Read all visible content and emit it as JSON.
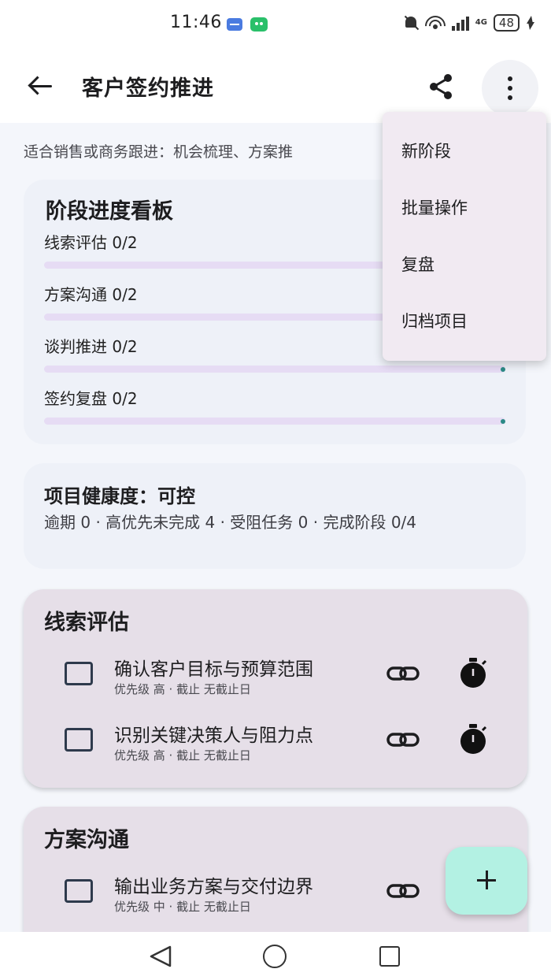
{
  "status_bar": {
    "time": "11:46",
    "network_label": "4G",
    "battery": "48",
    "icons": [
      "usb-icon",
      "wechat-icon",
      "bell-muted-icon",
      "wifi-icon",
      "signal-icon",
      "battery-icon",
      "charging-icon"
    ]
  },
  "app_bar": {
    "title": "客户签约推进",
    "icons": [
      "back-arrow-icon",
      "share-icon",
      "more-vert-icon"
    ]
  },
  "subtitle": "适合销售或商务跟进：机会梳理、方案推",
  "board": {
    "title": "阶段进度看板",
    "stages": [
      {
        "label": "线索评估  0/2",
        "progress": 0
      },
      {
        "label": "方案沟通  0/2",
        "progress": 0
      },
      {
        "label": "谈判推进  0/2",
        "progress": 0
      },
      {
        "label": "签约复盘  0/2",
        "progress": 0
      }
    ]
  },
  "health": {
    "title": "项目健康度：可控",
    "meta": "逾期 0 · 高优先未完成 4 · 受阻任务 0 · 完成阶段 0/4"
  },
  "sections": [
    {
      "title": "线索评估",
      "tasks": [
        {
          "name": "确认客户目标与预算范围",
          "meta": "优先级 高 · 截止 无截止日"
        },
        {
          "name": "识别关键决策人与阻力点",
          "meta": "优先级 高 · 截止 无截止日"
        }
      ]
    },
    {
      "title": "方案沟通",
      "tasks": [
        {
          "name": "输出业务方案与交付边界",
          "meta": "优先级 中 · 截止 无截止日"
        }
      ]
    }
  ],
  "menu": {
    "items": [
      "新阶段",
      "批量操作",
      "复盘",
      "归档项目"
    ]
  },
  "fab": {
    "icon": "plus-icon"
  },
  "nav_bar": {
    "icons": [
      "nav-back-icon",
      "nav-home-icon",
      "nav-recents-icon"
    ]
  },
  "colors": {
    "background": "#f4f6fb",
    "section_card": "#e6dfe8",
    "progress_track": "#e6dcf4",
    "progress_dot": "#2b8a86",
    "fab": "#b3f1e3",
    "menu": "#f1eaf2"
  }
}
